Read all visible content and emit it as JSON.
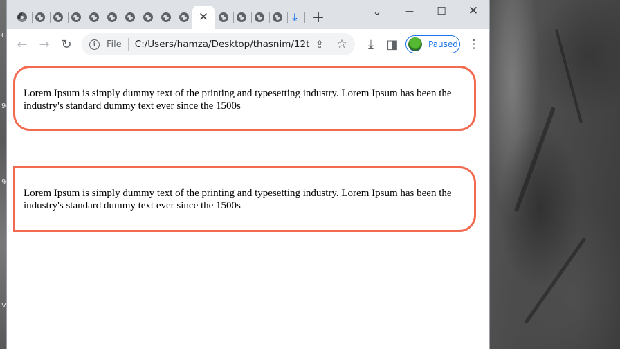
{
  "browser": {
    "tab_count_inactive": 13,
    "active_tab_close": "✕",
    "new_tab": "+",
    "window_controls": {
      "dropdown": "⌄",
      "minimize": "—",
      "maximize": "☐",
      "close": "✕"
    },
    "toolbar": {
      "back": "←",
      "forward": "→",
      "reload": "↻",
      "scheme_label": "File",
      "url": "C:/Users/hamza/Desktop/thasnim/12ta...",
      "share": "⇪",
      "bookmark": "☆",
      "downloads": "⤓",
      "sidepanel": "◨",
      "profile_status": "Paused",
      "menu": "⋮"
    }
  },
  "page": {
    "paragraphs": [
      "Lorem Ipsum is simply dummy text of the printing and typesetting industry. Lorem Ipsum has been the industry's standard dummy text ever since the 1500s",
      "Lorem Ipsum is simply dummy text of the printing and typesetting industry. Lorem Ipsum has been the industry's standard dummy text ever since the 1500s"
    ]
  },
  "desktop": {
    "edge_letters": [
      "G",
      "9",
      "9",
      "V"
    ]
  },
  "colors": {
    "box_border": "#f26a4f",
    "accent": "#1a73e8",
    "tabstrip": "#dee1e6"
  }
}
